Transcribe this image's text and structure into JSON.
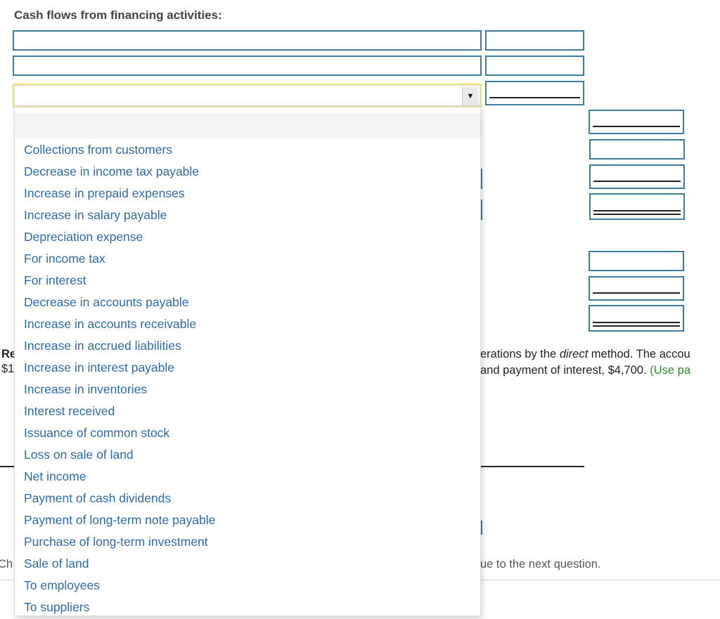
{
  "section": {
    "heading": "Cash flows from financing activities:"
  },
  "select": {
    "selected_value": "",
    "arrow_icon": "▼"
  },
  "dropdown": {
    "blank_option": "",
    "options": [
      "Collections from customers",
      "Decrease in income tax payable",
      "Increase in prepaid expenses",
      "Increase in salary payable",
      "Depreciation expense",
      "For income tax",
      "For interest",
      "Decrease in accounts payable",
      "Increase in accounts receivable",
      "Increase in accrued liabilities",
      "Increase in interest payable",
      "Increase in inventories",
      "Interest received",
      "Issuance of common stock",
      "Loss on sale of land",
      "Net income",
      "Payment of cash dividends",
      "Payment of long-term note payable",
      "Purchase of long-term investment",
      "Sale of land",
      "To employees",
      "To suppliers"
    ]
  },
  "background_text": {
    "req_label_fragment": "Re",
    "dollar_fragment": "$1",
    "line1_fragment_a": "erations by the ",
    "line1_italic": "direct",
    "line1_fragment_b": " method. The accou",
    "line2_fragment": "and payment of interest, $4,700. ",
    "line2_hint": "(Use pa",
    "choose_fragment": "Ch",
    "continue_fragment": "ue to the next question."
  }
}
